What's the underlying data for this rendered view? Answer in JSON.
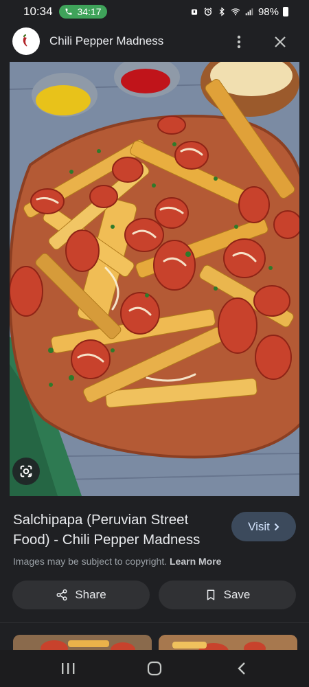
{
  "status_bar": {
    "time": "10:34",
    "call_timer": "34:17",
    "battery": "98%",
    "icons": [
      "alarm-icon",
      "alarm-clock-icon",
      "bluetooth-icon",
      "wifi-icon",
      "signal-icon",
      "battery-icon"
    ]
  },
  "header": {
    "site_icon": "chili-pepper-icon",
    "site_name": "Chili Pepper Madness",
    "more_icon": "more-vertical-icon",
    "close_icon": "close-icon"
  },
  "image": {
    "lens_icon": "google-lens-icon"
  },
  "result": {
    "title": "Salchipapa (Peruvian Street Food) - Chili Pepper Madness",
    "visit_label": "Visit",
    "copyright_text": "Images may be subject to copyright.",
    "learn_more": "Learn More"
  },
  "actions": {
    "share_label": "Share",
    "save_label": "Save"
  },
  "nav": {
    "icons": [
      "recents-icon",
      "home-icon",
      "back-icon"
    ]
  },
  "colors": {
    "background": "#1f2023",
    "button": "#303134",
    "visit_button": "#3c4a5c",
    "call_pill": "#3fa35a"
  }
}
